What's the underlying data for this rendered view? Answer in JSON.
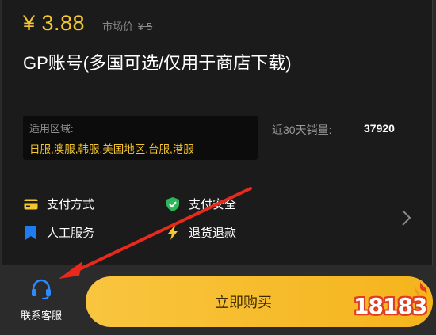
{
  "product": {
    "price": "¥ 3.88",
    "market_price_label": "市场价",
    "market_price_value": "¥ 5",
    "title": "GP账号(多国可选/仅用于商店下载)",
    "region_label": "适用区域:",
    "region_value": "日服,澳服,韩服,美国地区,台服,港服",
    "sales_label": "近30天销量:",
    "sales_value": "37920"
  },
  "features": {
    "payment_method": "支付方式",
    "payment_security": "支付安全",
    "human_service": "人工服务",
    "refund": "退货退款"
  },
  "bottom": {
    "customer_service": "联系客服",
    "buy_now": "立即购买",
    "logo_text": "18183"
  },
  "colors": {
    "accent": "#f5c630",
    "background": "#1b1b1b",
    "arrow": "#e8291c",
    "security_icon": "#2fb65a",
    "service_icon": "#1e7cf0",
    "cs_icon": "#2e8bff"
  }
}
